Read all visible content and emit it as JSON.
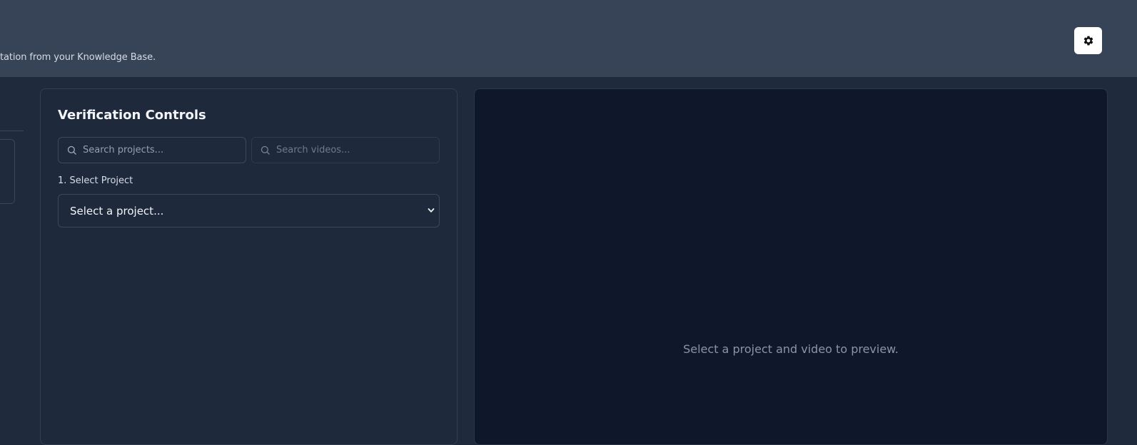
{
  "header": {
    "subtitle": "tation from your Knowledge Base.",
    "settings_icon": "gear-icon"
  },
  "controls": {
    "title": "Verification Controls",
    "search_projects": {
      "placeholder": "Search projects...",
      "icon": "search-icon"
    },
    "search_videos": {
      "placeholder": "Search videos...",
      "icon": "search-icon"
    },
    "project_label": "1. Select Project",
    "project_select": {
      "selected": "Select a project...",
      "icon": "chevron-down-icon"
    }
  },
  "preview": {
    "message": "Select a project and video to preview."
  },
  "colors": {
    "header_bg": "#374357",
    "page_bg": "#1f2a3c",
    "panel_bg": "#1e293c",
    "preview_bg": "#0f172a",
    "settings_button_bg": "#ffffff"
  }
}
